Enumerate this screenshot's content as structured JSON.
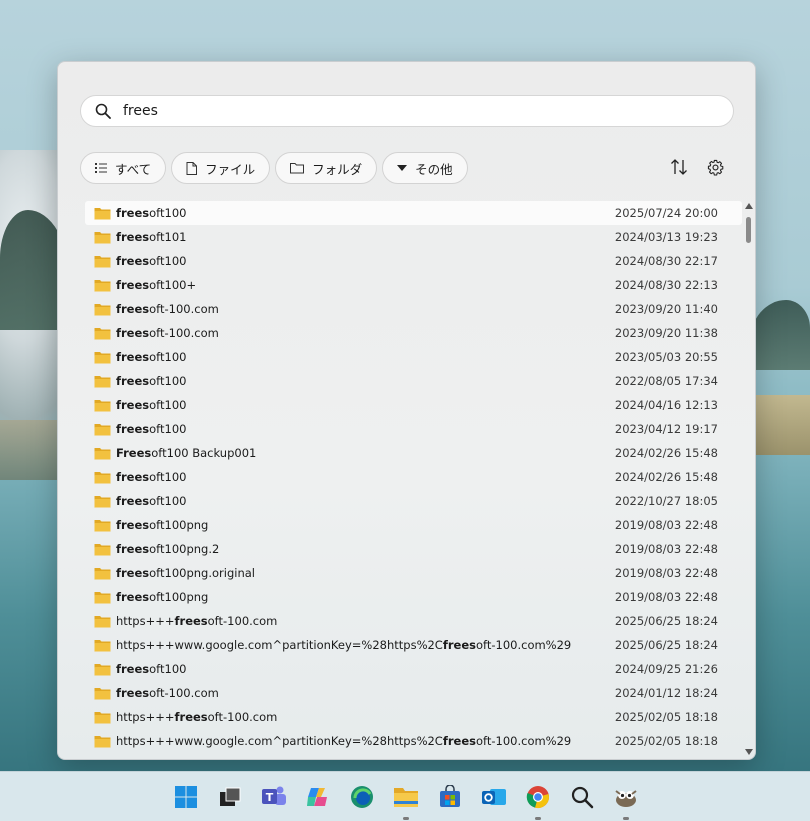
{
  "search": {
    "value": "frees",
    "icon": "search-icon"
  },
  "filters": [
    {
      "label": "すべて",
      "icon": "list-icon"
    },
    {
      "label": "ファイル",
      "icon": "file-icon"
    },
    {
      "label": "フォルダ",
      "icon": "folder-icon"
    },
    {
      "label": "その他",
      "icon": "triangle-down-icon"
    }
  ],
  "toolbar": {
    "sort_icon": "sort-icon",
    "settings_icon": "gear-icon"
  },
  "colors": {
    "folder": "#f2c13f",
    "folder_dark": "#e2a924",
    "accent": "#0067c0"
  },
  "results": [
    {
      "pre": "",
      "match": "frees",
      "post": "oft100",
      "date": "2025/07/24 20:00"
    },
    {
      "pre": "",
      "match": "frees",
      "post": "oft101",
      "date": "2024/03/13 19:23"
    },
    {
      "pre": "",
      "match": "frees",
      "post": "oft100",
      "date": "2024/08/30 22:17"
    },
    {
      "pre": "",
      "match": "frees",
      "post": "oft100+",
      "date": "2024/08/30 22:13"
    },
    {
      "pre": "",
      "match": "frees",
      "post": "oft-100.com",
      "date": "2023/09/20 11:40"
    },
    {
      "pre": "",
      "match": "frees",
      "post": "oft-100.com",
      "date": "2023/09/20 11:38"
    },
    {
      "pre": "",
      "match": "frees",
      "post": "oft100",
      "date": "2023/05/03 20:55"
    },
    {
      "pre": "",
      "match": "frees",
      "post": "oft100",
      "date": "2022/08/05 17:34"
    },
    {
      "pre": "",
      "match": "frees",
      "post": "oft100",
      "date": "2024/04/16 12:13"
    },
    {
      "pre": "",
      "match": "frees",
      "post": "oft100",
      "date": "2023/04/12 19:17"
    },
    {
      "pre": "",
      "match": "Frees",
      "post": "oft100 Backup001",
      "date": "2024/02/26 15:48"
    },
    {
      "pre": "",
      "match": "frees",
      "post": "oft100",
      "date": "2024/02/26 15:48"
    },
    {
      "pre": "",
      "match": "frees",
      "post": "oft100",
      "date": "2022/10/27 18:05"
    },
    {
      "pre": "",
      "match": "frees",
      "post": "oft100png",
      "date": "2019/08/03 22:48"
    },
    {
      "pre": "",
      "match": "frees",
      "post": "oft100png.2",
      "date": "2019/08/03 22:48"
    },
    {
      "pre": "",
      "match": "frees",
      "post": "oft100png.original",
      "date": "2019/08/03 22:48"
    },
    {
      "pre": "",
      "match": "frees",
      "post": "oft100png",
      "date": "2019/08/03 22:48"
    },
    {
      "pre": "https+++",
      "match": "frees",
      "post": "oft-100.com",
      "date": "2025/06/25 18:24"
    },
    {
      "pre": "https+++www.google.com^partitionKey=%28https%2C",
      "match": "frees",
      "post": "oft-100.com%29",
      "date": "2025/06/25 18:24"
    },
    {
      "pre": "",
      "match": "frees",
      "post": "oft100",
      "date": "2024/09/25 21:26"
    },
    {
      "pre": "",
      "match": "frees",
      "post": "oft-100.com",
      "date": "2024/01/12 18:24"
    },
    {
      "pre": "https+++",
      "match": "frees",
      "post": "oft-100.com",
      "date": "2025/02/05 18:18"
    },
    {
      "pre": "https+++www.google.com^partitionKey=%28https%2C",
      "match": "frees",
      "post": "oft-100.com%29",
      "date": "2025/02/05 18:18"
    }
  ],
  "scrollbar": {
    "position": 0.0
  },
  "taskbar": [
    {
      "icon": "windows-start-icon",
      "running": false
    },
    {
      "icon": "task-view-icon",
      "running": false
    },
    {
      "icon": "teams-icon",
      "running": false
    },
    {
      "icon": "copilot-icon",
      "running": false
    },
    {
      "icon": "edge-icon",
      "running": false
    },
    {
      "icon": "file-explorer-icon",
      "running": true
    },
    {
      "icon": "microsoft-store-icon",
      "running": false
    },
    {
      "icon": "outlook-icon",
      "running": false
    },
    {
      "icon": "chrome-icon",
      "running": true
    },
    {
      "icon": "search-app-icon",
      "running": false
    },
    {
      "icon": "gimp-icon",
      "running": true
    }
  ]
}
